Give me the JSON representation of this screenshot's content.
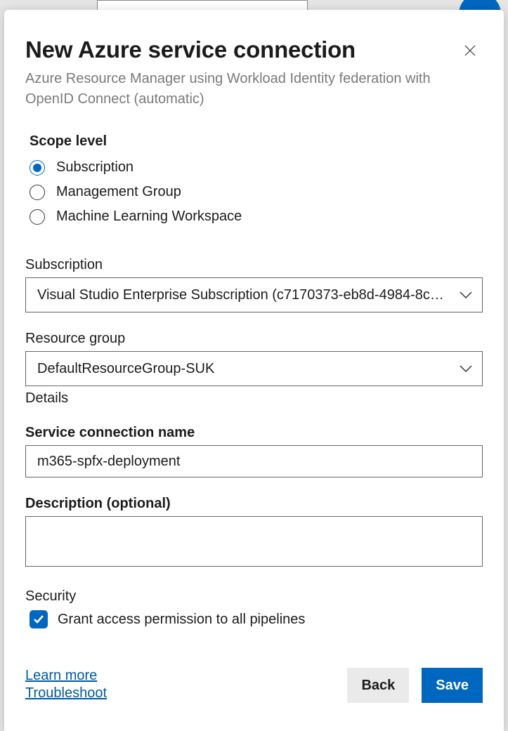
{
  "header": {
    "title": "New Azure service connection",
    "subtitle": "Azure Resource Manager using Workload Identity federation with OpenID Connect (automatic)"
  },
  "scope": {
    "label": "Scope level",
    "options": [
      "Subscription",
      "Management Group",
      "Machine Learning Workspace"
    ],
    "selected_index": 0
  },
  "subscription": {
    "label": "Subscription",
    "value": "Visual Studio Enterprise Subscription (c7170373-eb8d-4984-8c…"
  },
  "resource_group": {
    "label": "Resource group",
    "value": "DefaultResourceGroup-SUK",
    "details_label": "Details"
  },
  "connection_name": {
    "label": "Service connection name",
    "value": "m365-spfx-deployment"
  },
  "description": {
    "label": "Description (optional)",
    "value": ""
  },
  "security": {
    "label": "Security",
    "checkbox_label": "Grant access permission to all pipelines",
    "checked": true
  },
  "footer": {
    "learn_more": "Learn more",
    "troubleshoot": "Troubleshoot",
    "back": "Back",
    "save": "Save"
  }
}
